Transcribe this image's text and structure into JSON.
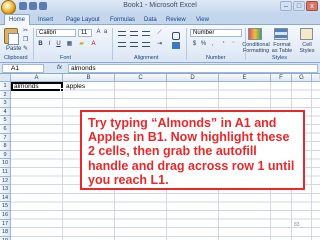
{
  "window": {
    "title": "Book1 - Microsoft Excel",
    "minimize": "–",
    "maximize": "□",
    "close": "x"
  },
  "ribbon_tabs": [
    "Home",
    "Insert",
    "Page Layout",
    "Formulas",
    "Data",
    "Review",
    "View"
  ],
  "ribbon": {
    "paste_label": "Paste",
    "font_name": "Calibri",
    "font_size": "11",
    "bold": "B",
    "italic": "I",
    "underline": "U",
    "number_format": "Number",
    "conditional_formatting": "Conditional Formatting",
    "format_as_table": "Format as Table",
    "cell_styles": "Cell Styles",
    "groups": [
      "Clipboard",
      "Font",
      "Alignment",
      "Number",
      "Styles"
    ]
  },
  "formula_bar": {
    "name_box": "A1",
    "fx": "fx",
    "value": "almonds"
  },
  "columns": [
    "A",
    "B",
    "C",
    "D",
    "E",
    "F",
    "G",
    "H",
    "I",
    "J"
  ],
  "rows": [
    "1",
    "2",
    "3",
    "4",
    "5",
    "6",
    "7",
    "8",
    "9",
    "10",
    "11",
    "12",
    "13",
    "14",
    "15",
    "16",
    "17",
    "18",
    "19"
  ],
  "cells": {
    "A1": "almonds",
    "B1": "apples"
  },
  "callout": {
    "text": "Try typing “Almonds” in A1 and Apples in B1.  Now highlight these 2 cells, then grab the autofill handle and drag across row 1 until you reach L1.",
    "color": "#e8282a"
  },
  "slide_number": "83",
  "colors": {
    "ribbon_blue": "#c4d6ec",
    "header_text": "#15428b",
    "selection_border": "#000000"
  }
}
